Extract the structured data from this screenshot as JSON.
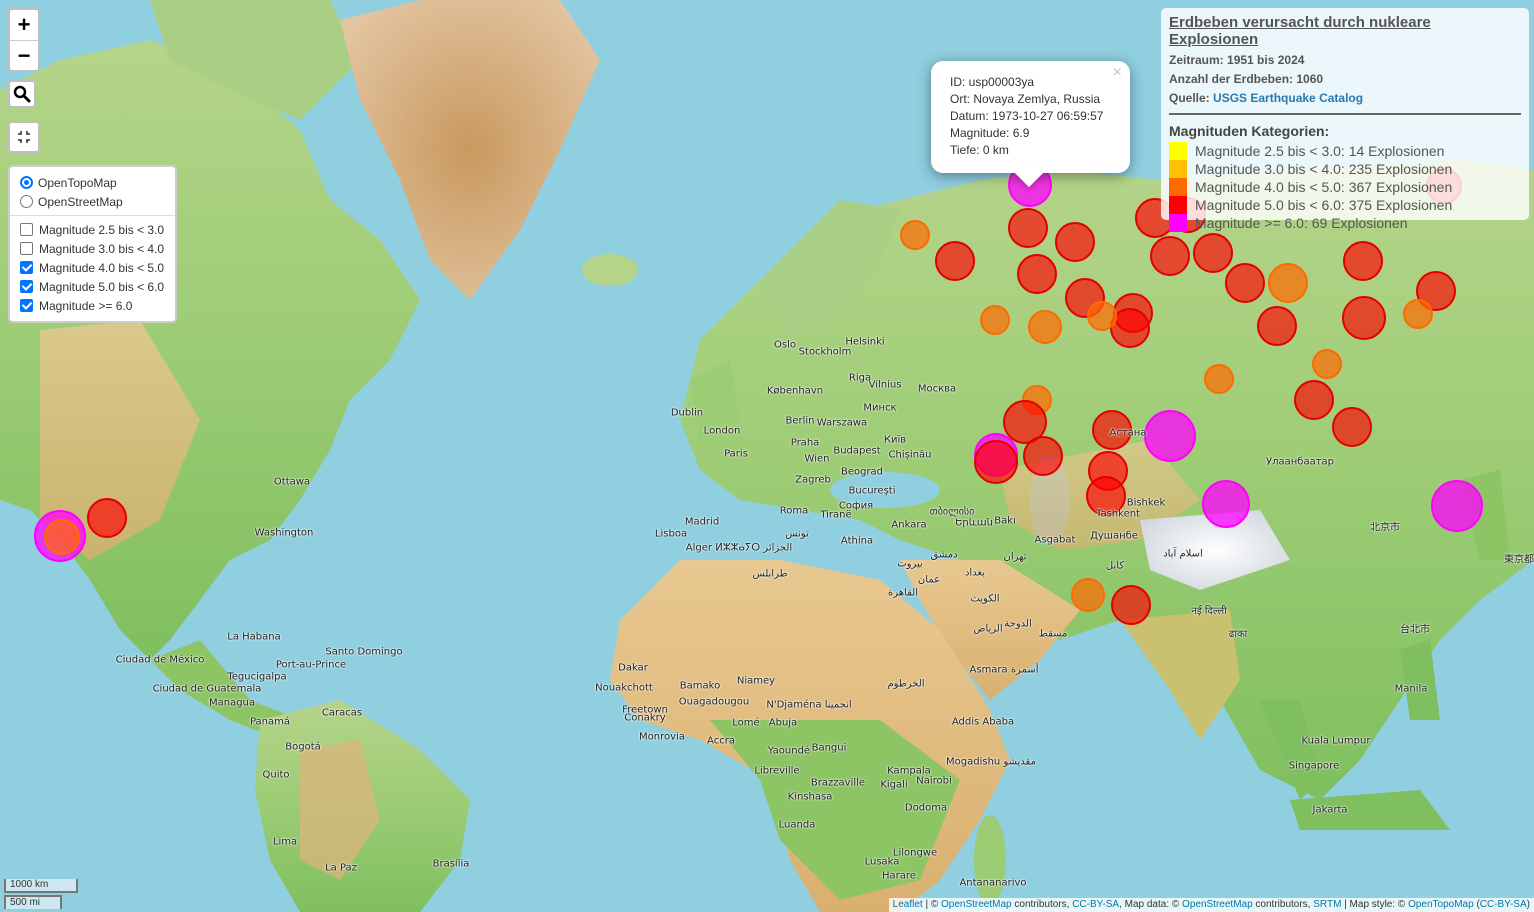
{
  "controls": {
    "zoom_in": "+",
    "zoom_out": "−",
    "search_icon": "search-icon",
    "fullscreen_icon": "fullscreen-icon"
  },
  "layers": {
    "base": [
      {
        "label": "OpenTopoMap",
        "selected": true
      },
      {
        "label": "OpenStreetMap",
        "selected": false
      }
    ],
    "overlays": [
      {
        "label": "Magnitude 2.5 bis < 3.0",
        "checked": false
      },
      {
        "label": "Magnitude 3.0 bis < 4.0",
        "checked": false
      },
      {
        "label": "Magnitude 4.0 bis < 5.0",
        "checked": true
      },
      {
        "label": "Magnitude 5.0 bis < 6.0",
        "checked": true
      },
      {
        "label": "Magnitude >= 6.0",
        "checked": true
      }
    ]
  },
  "info": {
    "title": "Erdbeben verursacht durch nukleare Explosionen",
    "zeitraum_label": "Zeitraum:",
    "zeitraum_value": "1951 bis 2024",
    "anzahl_label": "Anzahl der Erdbeben:",
    "anzahl_value": "1060",
    "quelle_label": "Quelle:",
    "quelle_link": "USGS Earthquake Catalog",
    "categories_title": "Magnituden Kategorien:",
    "categories": [
      {
        "label": "Magnitude 2.5 bis < 3.0: 14 Explosionen",
        "color": "#ffff00"
      },
      {
        "label": "Magnitude 3.0 bis < 4.0: 235 Explosionen",
        "color": "#ffc000"
      },
      {
        "label": "Magnitude 4.0 bis < 5.0: 367 Explosionen",
        "color": "#ff6a00"
      },
      {
        "label": "Magnitude 5.0 bis < 6.0: 375 Explosionen",
        "color": "#ff0000"
      },
      {
        "label": "Magnitude >= 6.0: 69 Explosionen",
        "color": "#ff00ff"
      }
    ]
  },
  "popup": {
    "id": "ID: usp00003ya",
    "ort": "Ort: Novaya Zemlya, Russia",
    "datum": "Datum: 1973-10-27 06:59:57",
    "magnitude": "Magnitude: 6.9",
    "tiefe": "Tiefe: 0 km",
    "close": "×"
  },
  "scale": {
    "km": "1000 km",
    "mi": "500 mi"
  },
  "attribution": {
    "leaflet": "Leaflet",
    "sep1": " | © ",
    "osm1": "OpenStreetMap",
    "t1": " contributors, ",
    "ccbysa1": "CC-BY-SA",
    "t2": ", Map data: © ",
    "osm2": "OpenStreetMap",
    "t3": " contributors, ",
    "srtm": "SRTM",
    "t4": " | Map style: © ",
    "otm": "OpenTopoMap",
    "t5": " (",
    "ccbysa2": "CC-BY-SA",
    "t6": ")"
  },
  "cities": [
    "Oslo",
    "Stockholm",
    "Helsinki",
    "Riga",
    "Vilnius",
    "Москва",
    "København",
    "Berlin",
    "Warszawa",
    "Минск",
    "Dublin",
    "London",
    "Praha",
    "Wien",
    "Budapest",
    "Київ",
    "Chișinău",
    "Paris",
    "Zagreb",
    "Beograd",
    "București",
    "Roma",
    "Tiranë",
    "София",
    "Ankara",
    "Madrid",
    "Lisboa",
    "Alger ⵍⵣⵣⴰⵢⵔ الجزائر",
    "تونس",
    "Athína",
    "Ottawa",
    "Washington",
    "La Habana",
    "Santo Domingo",
    "Ciudad de México",
    "Port-au-Prince",
    "Ciudad de Guatemala",
    "Managua",
    "Tegucigalpa",
    "Panamá",
    "Caracas",
    "Bogotá",
    "Quito",
    "Lima",
    "La Paz",
    "Brasília",
    "طرابلس",
    "القاهرة",
    "دمشق",
    "بيروت",
    "عمان",
    "بغداد",
    "الكويت",
    "الرياض",
    "الدوحة",
    "مسقط",
    "Asgabat",
    "تهران",
    "Bakı",
    "თბილისი",
    "Երևան",
    "کابل",
    "اسلام آباد",
    "Bishkek",
    "Tashkent",
    "Душанбе",
    "Астана",
    "Улаанбаатар",
    "北京市",
    "नई दिल्ली",
    "ढाका",
    "台北市",
    "Manila",
    "Kuala Lumpur",
    "Singapore",
    "Jakarta",
    "東京都",
    "Asmara أسمرة",
    "Addis Ababa",
    "الخرطوم",
    "Mogadishu مقديشو",
    "Kampala",
    "Nairobi",
    "Kigali",
    "Dodoma",
    "Lilongwe",
    "Lusaka",
    "Harare",
    "Antananarivo",
    "Luanda",
    "Kinshasa",
    "Brazzaville",
    "Bangui",
    "Yaoundé",
    "Libreville",
    "Abuja",
    "Lomé",
    "Accra",
    "Niamey",
    "Bamako",
    "Ouagadougou",
    "Dakar",
    "Nouakchott",
    "Conakry",
    "Freetown",
    "Monrovia",
    "N'Djaména انجمينا"
  ]
}
